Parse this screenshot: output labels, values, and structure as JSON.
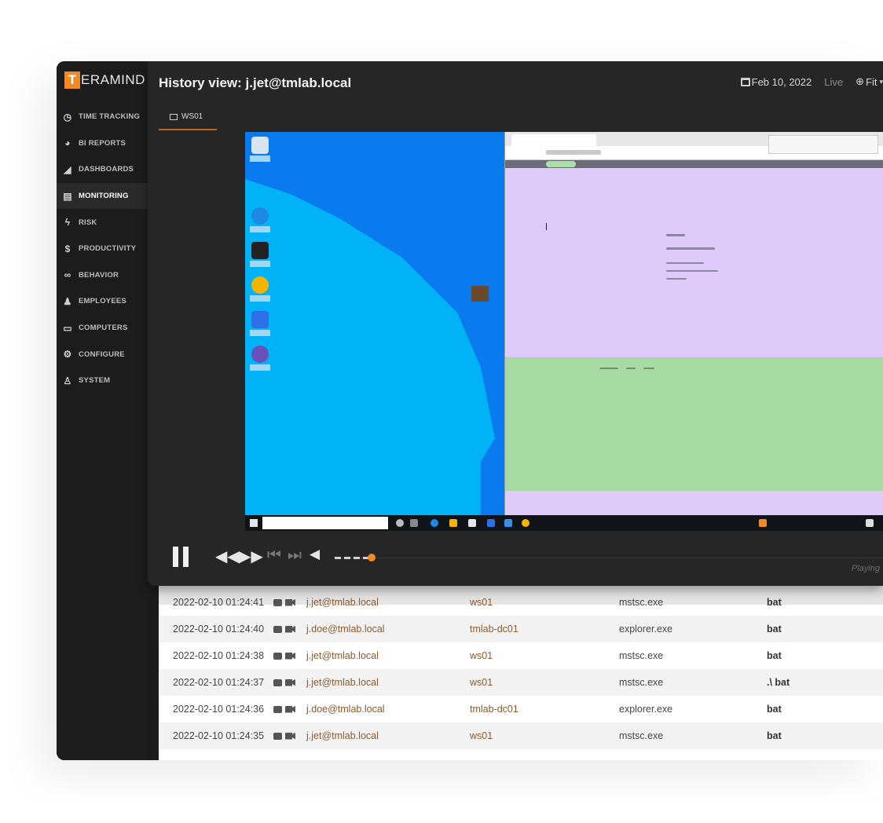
{
  "brand": {
    "logo_letter": "T",
    "logo_rest": "ERAMIND",
    "accent": "#f08a24"
  },
  "sidebar": {
    "items": [
      {
        "label": "TIME TRACKING",
        "icon": "clock-icon"
      },
      {
        "label": "BI REPORTS",
        "icon": "pie-chart-icon"
      },
      {
        "label": "DASHBOARDS",
        "icon": "area-chart-icon"
      },
      {
        "label": "MONITORING",
        "icon": "document-icon",
        "active": true
      },
      {
        "label": "RISK",
        "icon": "lightning-icon"
      },
      {
        "label": "PRODUCTIVITY",
        "icon": "dollar-icon"
      },
      {
        "label": "BEHAVIOR",
        "icon": "glasses-icon"
      },
      {
        "label": "EMPLOYEES",
        "icon": "user-icon"
      },
      {
        "label": "COMPUTERS",
        "icon": "monitor-icon"
      },
      {
        "label": "CONFIGURE",
        "icon": "gear-icon"
      },
      {
        "label": "SYSTEM",
        "icon": "user-admin-icon"
      }
    ]
  },
  "header": {
    "title": "History view: j.jet@tmlab.local",
    "date": "Feb 10, 2022",
    "live": "Live",
    "zoom": "Fit"
  },
  "tabs": [
    {
      "label": "WS01"
    }
  ],
  "player": {
    "status": "Playing"
  },
  "table": {
    "rows": [
      {
        "time": "2022-02-10 01:24:41",
        "user": "j.jet@tmlab.local",
        "computer": "ws01",
        "process": "mstsc.exe",
        "activity": "bat"
      },
      {
        "time": "2022-02-10 01:24:40",
        "user": "j.doe@tmlab.local",
        "computer": "tmlab-dc01",
        "process": "explorer.exe",
        "activity": "bat"
      },
      {
        "time": "2022-02-10 01:24:38",
        "user": "j.jet@tmlab.local",
        "computer": "ws01",
        "process": "mstsc.exe",
        "activity": "bat"
      },
      {
        "time": "2022-02-10 01:24:37",
        "user": "j.jet@tmlab.local",
        "computer": "ws01",
        "process": "mstsc.exe",
        "activity": ".\\ bat"
      },
      {
        "time": "2022-02-10 01:24:36",
        "user": "j.doe@tmlab.local",
        "computer": "tmlab-dc01",
        "process": "explorer.exe",
        "activity": "bat"
      },
      {
        "time": "2022-02-10 01:24:35",
        "user": "j.jet@tmlab.local",
        "computer": "ws01",
        "process": "mstsc.exe",
        "activity": "bat"
      }
    ]
  }
}
